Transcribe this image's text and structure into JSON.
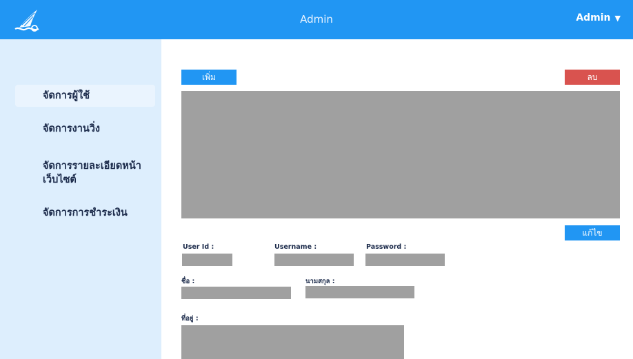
{
  "header": {
    "title": "Admin",
    "user_label": "Admin",
    "caret": "▼",
    "logo_icon": "sailboat-logo-icon",
    "bg_color": "#2196f3"
  },
  "sidebar": {
    "items": [
      {
        "label": "จัดการผู้ใช้",
        "active": true
      },
      {
        "label": "จัดการงานวิ่ง",
        "active": false
      },
      {
        "label": "จัดการรายละเอียดหน้าเว็บไซต์",
        "active": false
      },
      {
        "label": "จัดการการชำระเงิน",
        "active": false
      }
    ],
    "bg_color": "#ddeefd"
  },
  "toolbar": {
    "add_label": "เพิ่ม",
    "delete_label": "ลบ",
    "edit_label": "แก้ไข",
    "delete_color": "#d9534f"
  },
  "form": {
    "user_id_label": "User Id :",
    "username_label": "Username :",
    "password_label": "Password :",
    "first_name_label": "ชื่อ :",
    "last_name_label": "นามสกุล :",
    "address_label": "ที่อยู่ :",
    "user_id_value": "",
    "username_value": "",
    "password_value": "",
    "first_name_value": "",
    "last_name_value": "",
    "address_value": ""
  }
}
